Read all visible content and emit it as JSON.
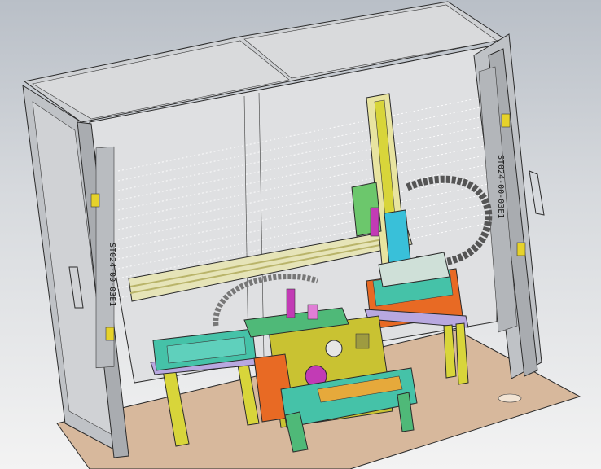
{
  "viewport": {
    "background_top": "#b9bfc7",
    "background_bottom": "#f3f3f3"
  },
  "part_labels": {
    "left_door": "ST024-00-03E1",
    "right_door": "ST024-00-03E1"
  },
  "colors": {
    "frame": "#c7c9cc",
    "frame_shadow": "#9ea2a7",
    "panel": "#d2d4d6",
    "base_plate": "#d7b89c",
    "yellow": "#d8d53a",
    "olive": "#b8b244",
    "green": "#4fb978",
    "teal": "#45c2a8",
    "cyan": "#39c0d9",
    "magenta": "#c23bb5",
    "orange": "#e36a1a",
    "lavender": "#b8a8e0"
  }
}
